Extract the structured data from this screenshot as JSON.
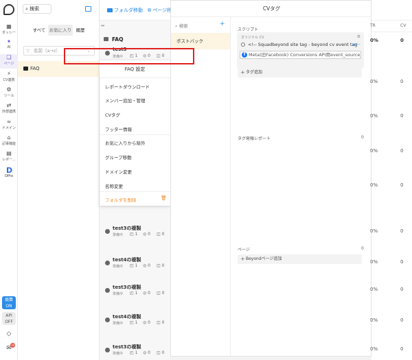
{
  "rail": {
    "items": [
      {
        "label": "ダッシー",
        "icon": "grid-icon"
      },
      {
        "label": "AI",
        "icon": "sparkle-icon"
      },
      {
        "label": "ページ",
        "icon": "page-icon"
      },
      {
        "label": "CV連携",
        "icon": "bolt-icon"
      },
      {
        "label": "ツール",
        "icon": "tool-icon"
      },
      {
        "label": "外部連携",
        "icon": "arrows-icon"
      },
      {
        "label": "ドメイン",
        "icon": "link-icon"
      },
      {
        "label": "記事機能",
        "icon": "article-icon"
      },
      {
        "label": "レポー...",
        "icon": "report-icon"
      }
    ],
    "dpro_label": "DPro",
    "on_badge": {
      "line1": "換算",
      "line2": "ON"
    },
    "off_badge": {
      "line1": "API",
      "line2": "OFF"
    },
    "notification_count": "10"
  },
  "folders": {
    "search_label": "検索",
    "tabs": [
      "すべて",
      "お気に入り",
      "履歴"
    ],
    "sort_placeholder": "名前（a→z）",
    "folder_name": "FAQ"
  },
  "list": {
    "move_folder": "フォルダ移動",
    "page_move": "ページ移",
    "expand": "↔",
    "header": "FAQ",
    "items": [
      {
        "name": "test3",
        "status": "準備中",
        "m1": "1",
        "m2": "0",
        "m3": "0"
      },
      {
        "name": "test3の複製",
        "status": "準備中",
        "m1": "1",
        "m2": "0",
        "m3": "0"
      },
      {
        "name": "test4の複製",
        "status": "準備中",
        "m1": "1",
        "m2": "0",
        "m3": "0"
      },
      {
        "name": "test3の複製",
        "status": "準備中",
        "m1": "1",
        "m2": "0",
        "m3": "0"
      },
      {
        "name": "test4の複製",
        "status": "準備中",
        "m1": "1",
        "m2": "0",
        "m3": "0"
      },
      {
        "name": "test3の複製",
        "status": "準備中",
        "m1": "1",
        "m2": "0",
        "m3": "0"
      }
    ]
  },
  "menu": {
    "title": "FAQ 設定",
    "items": [
      "レポートダウンロード",
      "メンバー追加・管理",
      "CVタグ",
      "フッター情報",
      "お気に入りから除外",
      "グループ移動",
      "ドメイン変更",
      "名称変更"
    ],
    "delete_label": "フォルダを削除"
  },
  "modal": {
    "title": "CVタグ",
    "search_label": "検索",
    "left_item": "ポストバック",
    "script_label": "スクリプト",
    "orig_label": "オリジナル CV",
    "tag_line": "<!-- Squadbeyond site tag - beyond cv event tag",
    "copy_label": "コピー",
    "meta_field": "Meta(旧Facebook) Conversions API用event_source_url",
    "add_tag": "タグ追加",
    "report_label": "タグ発報レポート",
    "report_count": "0",
    "page_label": "ページ",
    "page_count": "0",
    "beyond_add": "Beyondページ追加"
  },
  "table": {
    "headers": [
      "TR",
      "CV"
    ],
    "rows": [
      [
        "0%",
        "0"
      ],
      [
        "0%",
        "0"
      ],
      [
        "0%",
        "0"
      ],
      [
        "0%",
        "0"
      ],
      [
        "0%",
        "0"
      ],
      [
        "0%",
        "0"
      ],
      [
        "0%",
        "0"
      ],
      [
        "0%",
        "0"
      ],
      [
        "0%",
        "0"
      ],
      [
        "0%",
        "0"
      ]
    ]
  }
}
